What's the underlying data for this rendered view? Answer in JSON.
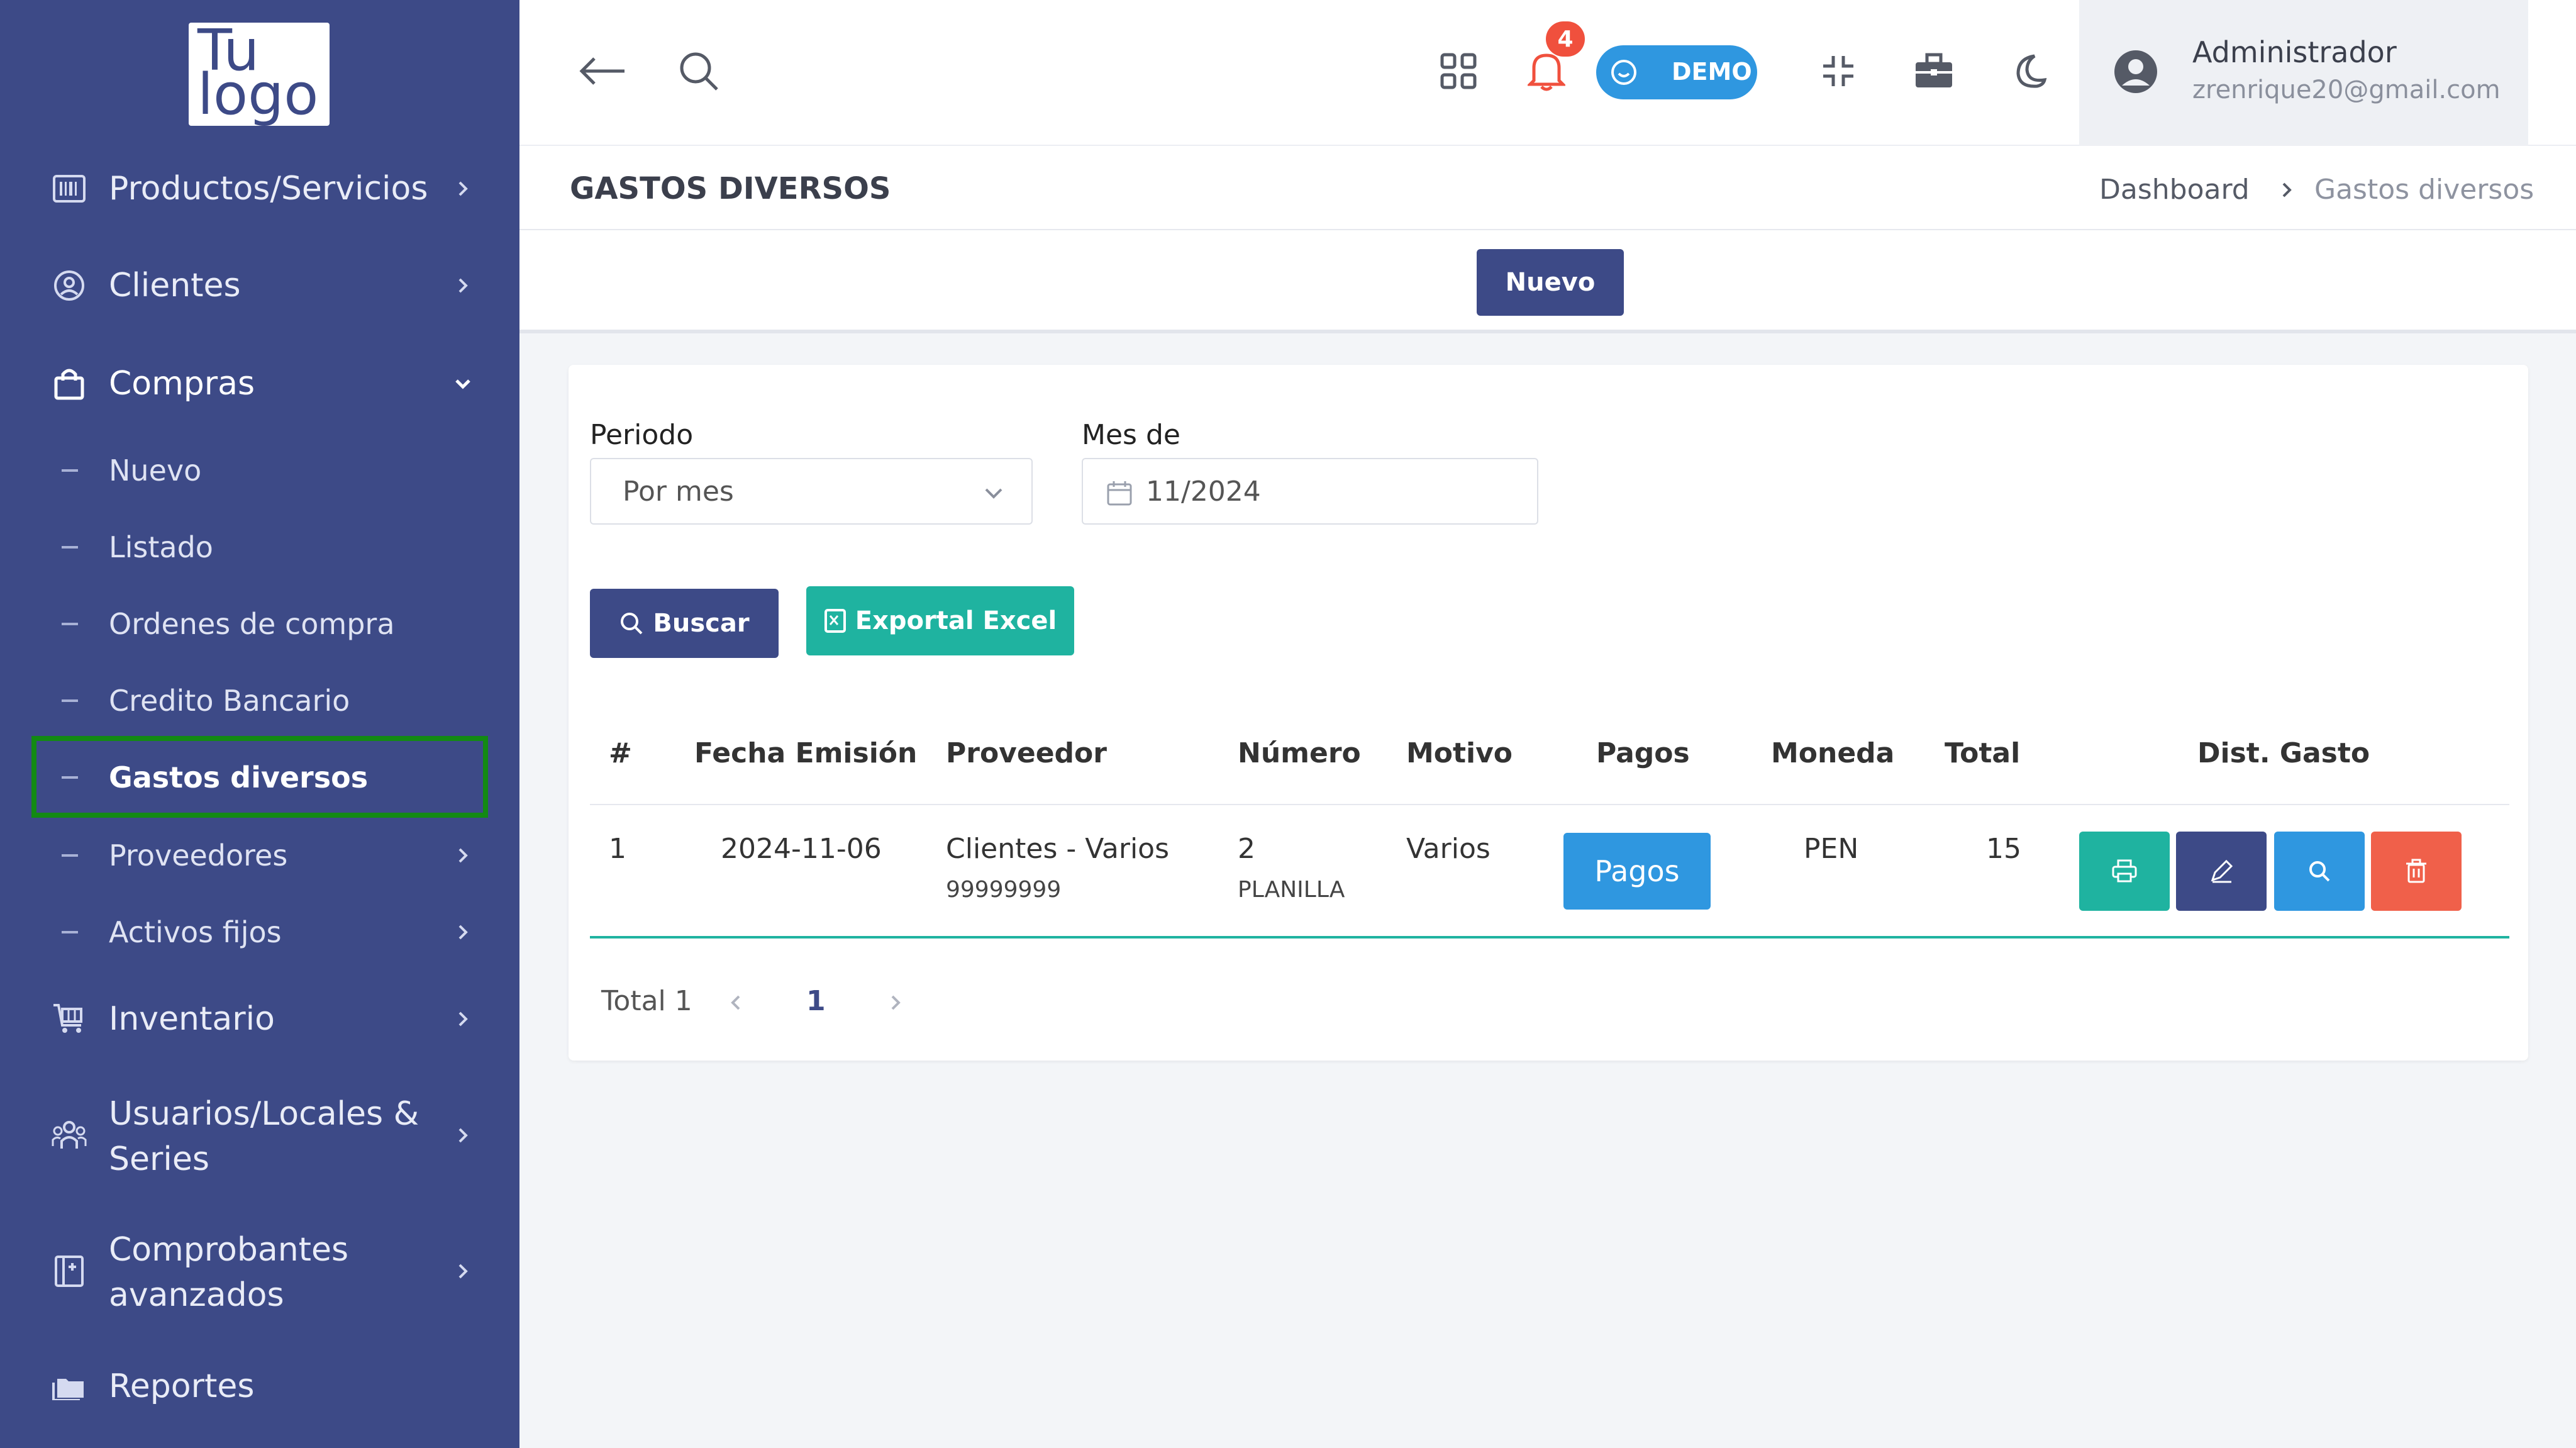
{
  "logo": {
    "line1": "Tu",
    "line2": "logo"
  },
  "sidebar": {
    "items": [
      {
        "label": "Productos/Servicios",
        "icon": "barcode-icon"
      },
      {
        "label": "Clientes",
        "icon": "user-circle-icon"
      },
      {
        "label": "Compras",
        "icon": "shopping-bag-icon",
        "expanded": true
      },
      {
        "label": "Inventario",
        "icon": "cart-icon"
      },
      {
        "label": "Usuarios/Locales & Series",
        "line1": "Usuarios/Locales &",
        "line2": "Series",
        "icon": "users-icon"
      },
      {
        "label": "Comprobantes avanzados",
        "line1": "Comprobantes",
        "line2": "avanzados",
        "icon": "document-icon"
      },
      {
        "label": "Reportes",
        "icon": "folders-icon"
      }
    ],
    "compras_sub": [
      {
        "label": "Nuevo"
      },
      {
        "label": "Listado"
      },
      {
        "label": "Ordenes de compra"
      },
      {
        "label": "Credito Bancario"
      },
      {
        "label": "Gastos diversos",
        "active": true
      },
      {
        "label": "Proveedores"
      },
      {
        "label": "Activos fijos"
      }
    ]
  },
  "topbar": {
    "notifications_count": "4",
    "demo_label": "DEMO",
    "icons": [
      "back-arrow-icon",
      "search-icon",
      "apps-grid-icon",
      "bell-icon",
      "compress-icon",
      "briefcase-icon",
      "moon-icon"
    ]
  },
  "user": {
    "name": "Administrador",
    "email": "zrenrique20@gmail.com"
  },
  "page": {
    "title": "GASTOS DIVERSOS",
    "breadcrumb": [
      "Dashboard",
      "Gastos diversos"
    ],
    "new_button": "Nuevo"
  },
  "filters": {
    "periodo_label": "Periodo",
    "periodo_value": "Por mes",
    "mes_label": "Mes de",
    "mes_value": "11/2024",
    "search_button": "Buscar",
    "export_button": "Exportal Excel"
  },
  "table": {
    "headers": [
      "#",
      "Fecha Emisión",
      "Proveedor",
      "Número",
      "Motivo",
      "Pagos",
      "Moneda",
      "Total",
      "Dist. Gasto"
    ],
    "rows": [
      {
        "index": "1",
        "fecha": "2024-11-06",
        "proveedor": "Clientes - Varios",
        "proveedor_doc": "99999999",
        "numero": "2",
        "numero_tipo": "PLANILLA",
        "motivo": "Varios",
        "pagos_button": "Pagos",
        "moneda": "PEN",
        "total": "15"
      }
    ]
  },
  "pager": {
    "total": "Total 1",
    "current": "1"
  },
  "colors": {
    "sidebar": "#3d4a87",
    "accent_teal": "#1fb3a0",
    "accent_blue": "#2f97e0",
    "danger": "#f0604a",
    "highlight": "#138a13"
  }
}
